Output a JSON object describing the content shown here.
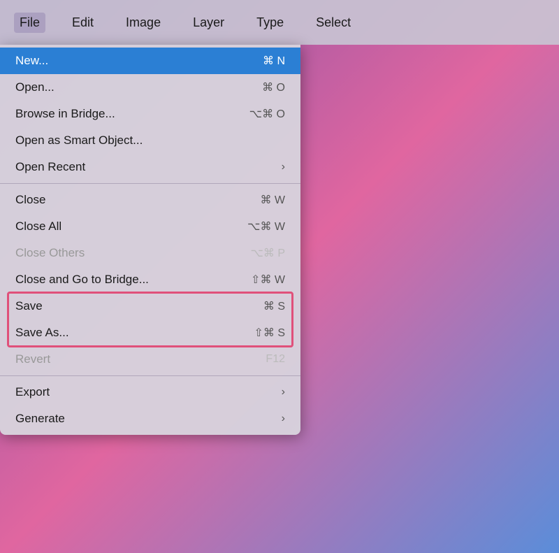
{
  "menuBar": {
    "items": [
      {
        "label": "File",
        "active": true
      },
      {
        "label": "Edit",
        "active": false
      },
      {
        "label": "Image",
        "active": false
      },
      {
        "label": "Layer",
        "active": false
      },
      {
        "label": "Type",
        "active": false
      },
      {
        "label": "Select",
        "active": false
      }
    ]
  },
  "fileMenu": {
    "items": [
      {
        "id": "new",
        "label": "New...",
        "shortcut": "⌘ N",
        "highlighted": true,
        "disabled": false,
        "hasSubmenu": false
      },
      {
        "id": "open",
        "label": "Open...",
        "shortcut": "⌘ O",
        "highlighted": false,
        "disabled": false,
        "hasSubmenu": false
      },
      {
        "id": "bridge",
        "label": "Browse in Bridge...",
        "shortcut": "⌥⌘ O",
        "highlighted": false,
        "disabled": false,
        "hasSubmenu": false
      },
      {
        "id": "smart-object",
        "label": "Open as Smart Object...",
        "shortcut": "",
        "highlighted": false,
        "disabled": false,
        "hasSubmenu": false
      },
      {
        "id": "open-recent",
        "label": "Open Recent",
        "shortcut": ">",
        "highlighted": false,
        "disabled": false,
        "hasSubmenu": true
      },
      {
        "separator": true
      },
      {
        "id": "close",
        "label": "Close",
        "shortcut": "⌘ W",
        "highlighted": false,
        "disabled": false,
        "hasSubmenu": false
      },
      {
        "id": "close-all",
        "label": "Close All",
        "shortcut": "⌥⌘ W",
        "highlighted": false,
        "disabled": false,
        "hasSubmenu": false
      },
      {
        "id": "close-others",
        "label": "Close Others",
        "shortcut": "⌥⌘ P",
        "highlighted": false,
        "disabled": true,
        "hasSubmenu": false
      },
      {
        "id": "close-bridge",
        "label": "Close and Go to Bridge...",
        "shortcut": "⇧⌘ W",
        "highlighted": false,
        "disabled": false,
        "hasSubmenu": false
      },
      {
        "id": "save",
        "label": "Save",
        "shortcut": "⌘ S",
        "highlighted": false,
        "disabled": false,
        "hasSubmenu": false,
        "saveHighlight": true
      },
      {
        "id": "save-as",
        "label": "Save As...",
        "shortcut": "⇧⌘ S",
        "highlighted": false,
        "disabled": false,
        "hasSubmenu": false,
        "saveHighlight": true
      },
      {
        "id": "revert",
        "label": "Revert",
        "shortcut": "F12",
        "highlighted": false,
        "disabled": true,
        "hasSubmenu": false
      },
      {
        "separator": true
      },
      {
        "id": "export",
        "label": "Export",
        "shortcut": ">",
        "highlighted": false,
        "disabled": false,
        "hasSubmenu": true
      },
      {
        "id": "generate",
        "label": "Generate",
        "shortcut": ">",
        "highlighted": false,
        "disabled": false,
        "hasSubmenu": true
      }
    ]
  }
}
